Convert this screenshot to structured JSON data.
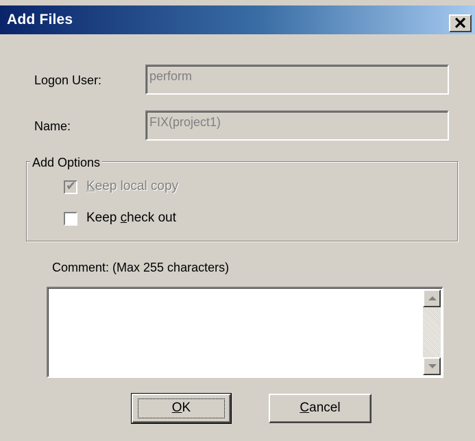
{
  "dialog": {
    "title": "Add Files",
    "close_glyph": "✕"
  },
  "fields": {
    "logon_user_label": "Logon User:",
    "logon_user_value": "perform",
    "name_label": "Name:",
    "name_value": "FIX(project1)"
  },
  "add_options": {
    "legend": "Add Options",
    "keep_local_copy": {
      "label_pre": "",
      "label_mnemonic": "K",
      "label_post": "eep local copy",
      "checked": true,
      "enabled": false
    },
    "keep_check_out": {
      "label_pre": "Keep ",
      "label_mnemonic": "c",
      "label_post": "heck out",
      "checked": false,
      "enabled": true
    }
  },
  "comment": {
    "label": "Comment: (Max 255 characters)",
    "value": ""
  },
  "buttons": {
    "ok": {
      "mnemonic": "O",
      "rest": "K"
    },
    "cancel": {
      "mnemonic": "C",
      "rest": "ancel"
    }
  },
  "colors": {
    "title_gradient_start": "#0a246a",
    "title_gradient_end": "#a6caf0",
    "dialog_bg": "#d4d0c8",
    "disabled_text": "#808080"
  }
}
